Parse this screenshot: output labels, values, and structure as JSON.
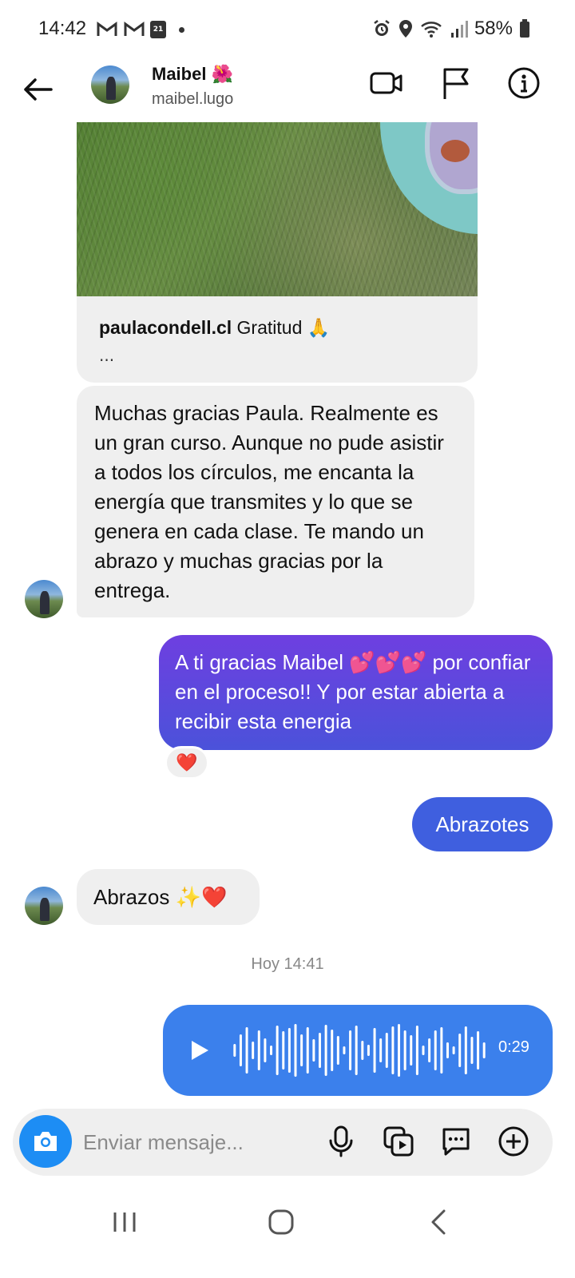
{
  "status_bar": {
    "time": "14:42",
    "calendar_day": "21",
    "battery": "58%",
    "icons": [
      "gmail-icon",
      "gmail-icon",
      "calendar-icon",
      "alarm-icon",
      "location-icon",
      "wifi-icon",
      "signal-icon",
      "battery-icon"
    ]
  },
  "header": {
    "name": "Maibel 🌺",
    "username": "maibel.lugo"
  },
  "shared_post": {
    "account": "paulacondell.cl",
    "caption": " Gratitud 🙏",
    "more": "..."
  },
  "messages": {
    "m1": "Muchas gracias Paula. Realmente es un gran curso. Aunque no pude asistir a todos los círculos, me encanta la energía que transmites y lo que se genera en cada clase. Te mando un abrazo y muchas gracias por la entrega.",
    "m2": "A ti gracias Maibel 💕💕💕 por confiar en el proceso!! Y por estar abierta a recibir esta energia",
    "m2_reaction": "❤️",
    "m3": "Abrazotes",
    "m4": "Abrazos ✨❤️"
  },
  "timestamp": "Hoy 14:41",
  "voice_message": {
    "duration": "0:29"
  },
  "composer": {
    "placeholder": "Enviar mensaje..."
  },
  "colors": {
    "outgoing_gradient_top": "#6e3fe0",
    "outgoing_gradient_bottom": "#4b52da",
    "outgoing_blue": "#3f5fdf",
    "voice_blue": "#3b80ec",
    "camera_blue": "#1d8df4",
    "incoming_gray": "#efefef"
  }
}
